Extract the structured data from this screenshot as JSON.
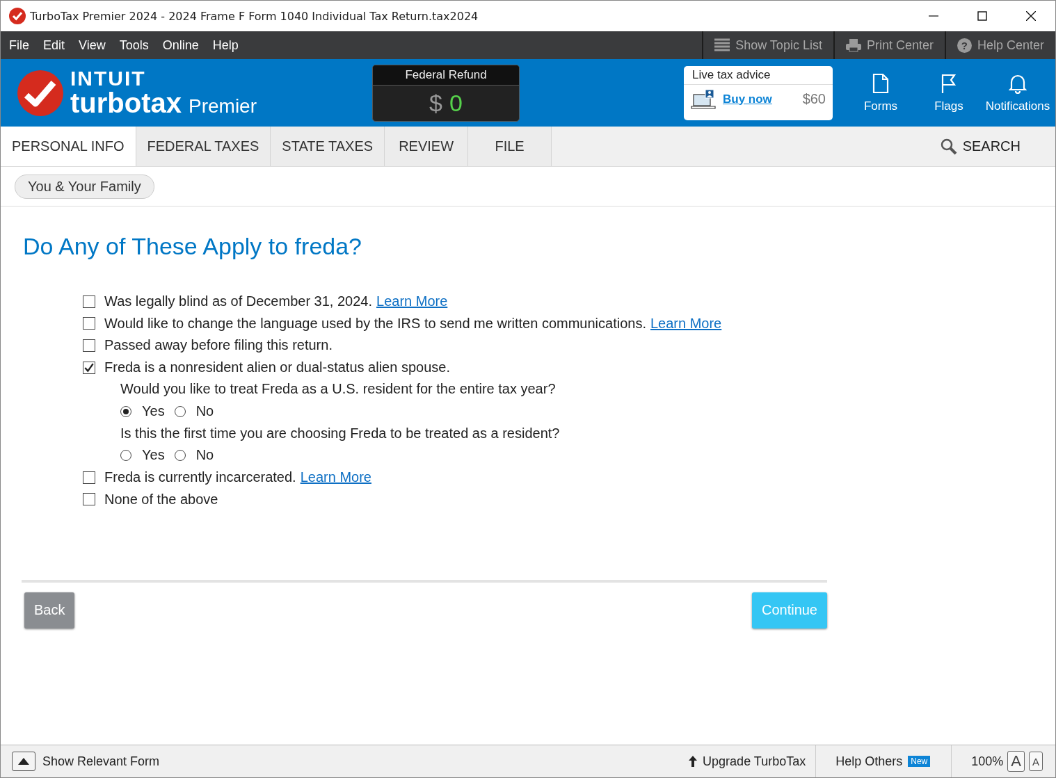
{
  "window": {
    "title": "TurboTax Premier 2024 - 2024 Frame F Form 1040  Individual Tax Return.tax2024"
  },
  "menu": [
    "File",
    "Edit",
    "View",
    "Tools",
    "Online",
    "Help"
  ],
  "toolbar": [
    {
      "label": "Show Topic List",
      "kind": "list"
    },
    {
      "label": "Print Center",
      "kind": "print"
    },
    {
      "label": "Help Center",
      "kind": "help",
      "icon": "?"
    }
  ],
  "brand": {
    "company": "INTUIT",
    "product": "turbotax",
    "edition": "Premier"
  },
  "refund": {
    "label": "Federal Refund",
    "currency": "$",
    "amount": "0"
  },
  "advice": {
    "title": "Live tax advice",
    "link": "Buy now",
    "price": "$60"
  },
  "header_buttons": [
    {
      "label": "Forms",
      "kind": "forms"
    },
    {
      "label": "Flags",
      "kind": "flags"
    },
    {
      "label": "Notifications",
      "kind": "notifications"
    }
  ],
  "tabs": [
    {
      "label": "PERSONAL INFO",
      "selected": true
    },
    {
      "label": "FEDERAL TAXES",
      "selected": false
    },
    {
      "label": "STATE TAXES",
      "selected": false
    },
    {
      "label": "REVIEW",
      "selected": false
    },
    {
      "label": "FILE",
      "selected": false
    }
  ],
  "search": "SEARCH",
  "breadcrumb": "You & Your Family",
  "heading": "Do Any of These Apply to freda?",
  "options": [
    {
      "text": "Was legally blind as of December 31, 2024.",
      "link": "Learn More",
      "checked": false
    },
    {
      "text": "Would like to change the language used by the IRS to send me written communications.",
      "link": "Learn More",
      "checked": false
    },
    {
      "text": "Passed away before filing this return.",
      "checked": false
    },
    {
      "text": "Freda is a nonresident alien or dual-status alien spouse.",
      "checked": true,
      "questions": [
        {
          "prompt": "Would you like to treat Freda as a U.S. resident for the entire tax year?",
          "choices": [
            {
              "label": "Yes",
              "selected": true
            },
            {
              "label": "No",
              "selected": false
            }
          ]
        },
        {
          "prompt": "Is this the first time you are choosing Freda to be treated as a resident?",
          "choices": [
            {
              "label": "Yes",
              "selected": false
            },
            {
              "label": "No",
              "selected": false
            }
          ]
        }
      ]
    },
    {
      "text": "Freda is currently incarcerated.",
      "link": "Learn More",
      "checked": false
    },
    {
      "text": "None of the above",
      "checked": false
    }
  ],
  "buttons": {
    "back": "Back",
    "continue": "Continue"
  },
  "footer": {
    "show_form": "Show Relevant Form",
    "upgrade": "Upgrade TurboTax",
    "help_others": "Help Others",
    "badge": "New",
    "zoom": "100%",
    "font_large": "A",
    "font_small": "A"
  }
}
